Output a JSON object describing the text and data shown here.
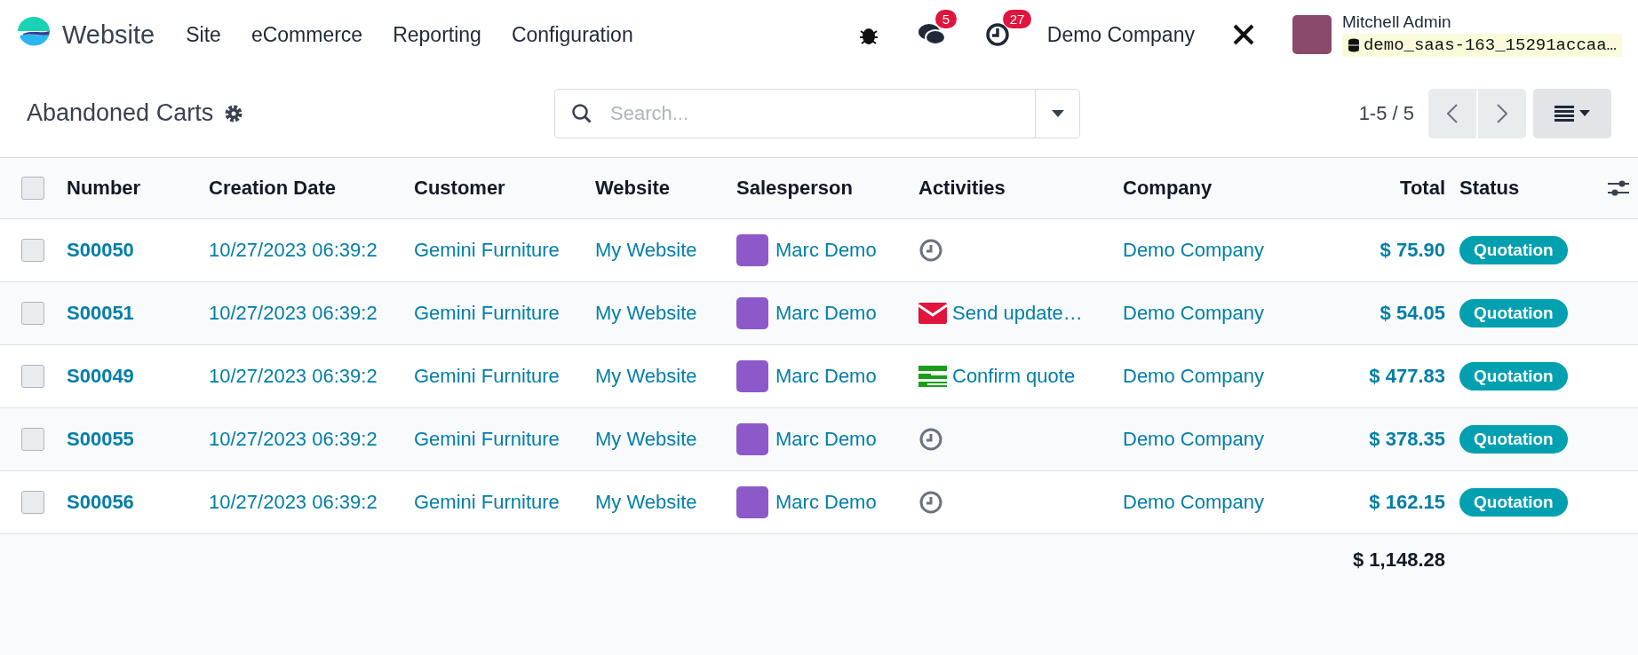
{
  "navbar": {
    "app_name": "Website",
    "menu": [
      "Site",
      "eCommerce",
      "Reporting",
      "Configuration"
    ],
    "messages_count": "5",
    "activities_count": "27",
    "company": "Demo Company",
    "user": {
      "name": "Mitchell Admin",
      "database": "demo_saas-163_15291accaa…"
    }
  },
  "control_panel": {
    "title": "Abandoned Carts",
    "search": {
      "placeholder": "Search..."
    },
    "pager": "1-5 / 5"
  },
  "table": {
    "select_all_checked": false,
    "columns": [
      "Number",
      "Creation Date",
      "Customer",
      "Website",
      "Salesperson",
      "Activities",
      "Company",
      "Total",
      "Status"
    ],
    "rows": [
      {
        "checked": false,
        "number": "S00050",
        "creation_date": "10/27/2023 06:39:2",
        "customer": "Gemini Furniture",
        "website": "My Website",
        "salesperson": "Marc Demo",
        "activity": {
          "kind": "none"
        },
        "company": "Demo Company",
        "total": "$ 75.90",
        "status": "Quotation"
      },
      {
        "checked": false,
        "number": "S00051",
        "creation_date": "10/27/2023 06:39:2",
        "customer": "Gemini Furniture",
        "website": "My Website",
        "salesperson": "Marc Demo",
        "activity": {
          "kind": "email",
          "label": "Send update…"
        },
        "company": "Demo Company",
        "total": "$ 54.05",
        "status": "Quotation"
      },
      {
        "checked": false,
        "number": "S00049",
        "creation_date": "10/27/2023 06:39:2",
        "customer": "Gemini Furniture",
        "website": "My Website",
        "salesperson": "Marc Demo",
        "activity": {
          "kind": "todo",
          "label": "Confirm quote"
        },
        "company": "Demo Company",
        "total": "$ 477.83",
        "status": "Quotation"
      },
      {
        "checked": false,
        "number": "S00055",
        "creation_date": "10/27/2023 06:39:2",
        "customer": "Gemini Furniture",
        "website": "My Website",
        "salesperson": "Marc Demo",
        "activity": {
          "kind": "none"
        },
        "company": "Demo Company",
        "total": "$ 378.35",
        "status": "Quotation"
      },
      {
        "checked": false,
        "number": "S00056",
        "creation_date": "10/27/2023 06:39:2",
        "customer": "Gemini Furniture",
        "website": "My Website",
        "salesperson": "Marc Demo",
        "activity": {
          "kind": "none"
        },
        "company": "Demo Company",
        "total": "$ 162.15",
        "status": "Quotation"
      }
    ],
    "grand_total": "$ 1,148.28"
  }
}
